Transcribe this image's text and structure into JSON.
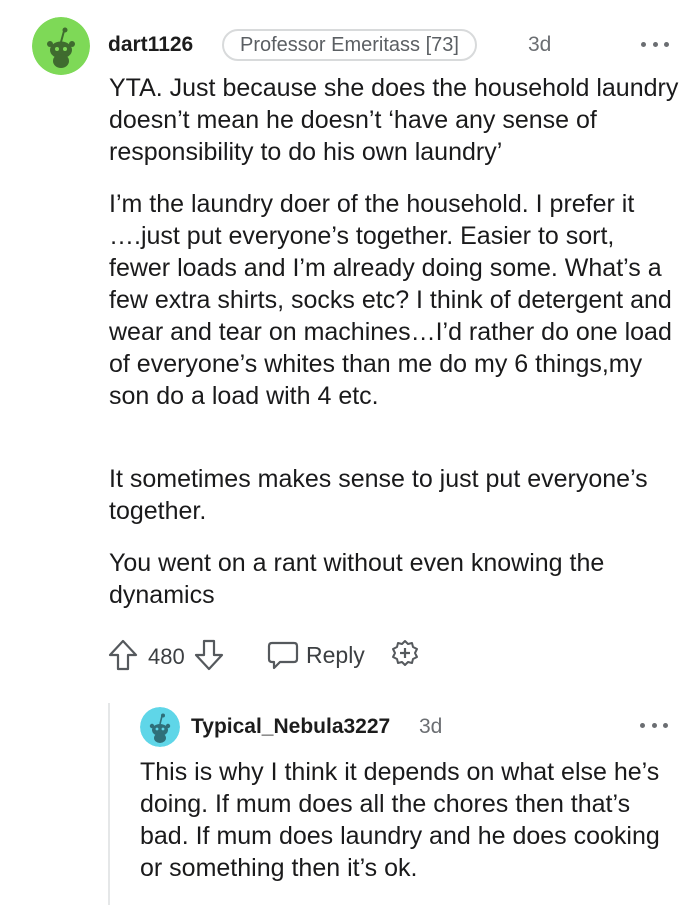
{
  "comment": {
    "username": "dart1126",
    "flair": "Professor Emeritass [73]",
    "time": "3d",
    "avatar_icon": "snoo-avatar-icon",
    "avatar_color": "#7ed957",
    "paragraphs": [
      "YTA. Just because she does the household laundry doesn’t mean he doesn’t ‘have any sense of responsibility to do his own laundry’",
      "I’m the laundry doer of the household. I prefer it ….just put everyone’s together. Easier to sort, fewer loads and I’m already doing some. What’s a few extra shirts, socks etc? I think of detergent and wear and tear on machines…I’d rather do one load of everyone’s whites than me do my 6 things,my son do a load with 4 etc.",
      "It sometimes makes sense to just put everyone’s together.",
      "You went on a rant without even knowing the dynamics"
    ],
    "votes": "480",
    "reply_label": "Reply",
    "icons": {
      "upvote": "upvote-arrow-icon",
      "downvote": "downvote-arrow-icon",
      "reply": "comment-bubble-icon",
      "award": "award-plus-icon",
      "more": "more-options-icon"
    }
  },
  "reply": {
    "username": "Typical_Nebula3227",
    "time": "3d",
    "avatar_icon": "snoo-avatar-icon",
    "avatar_color": "#5fd6e8",
    "text": "This is why I think it depends on what else he’s doing. If mum does all the chores then that’s bad. If mum does laundry and he does cooking or something then it’s ok."
  }
}
